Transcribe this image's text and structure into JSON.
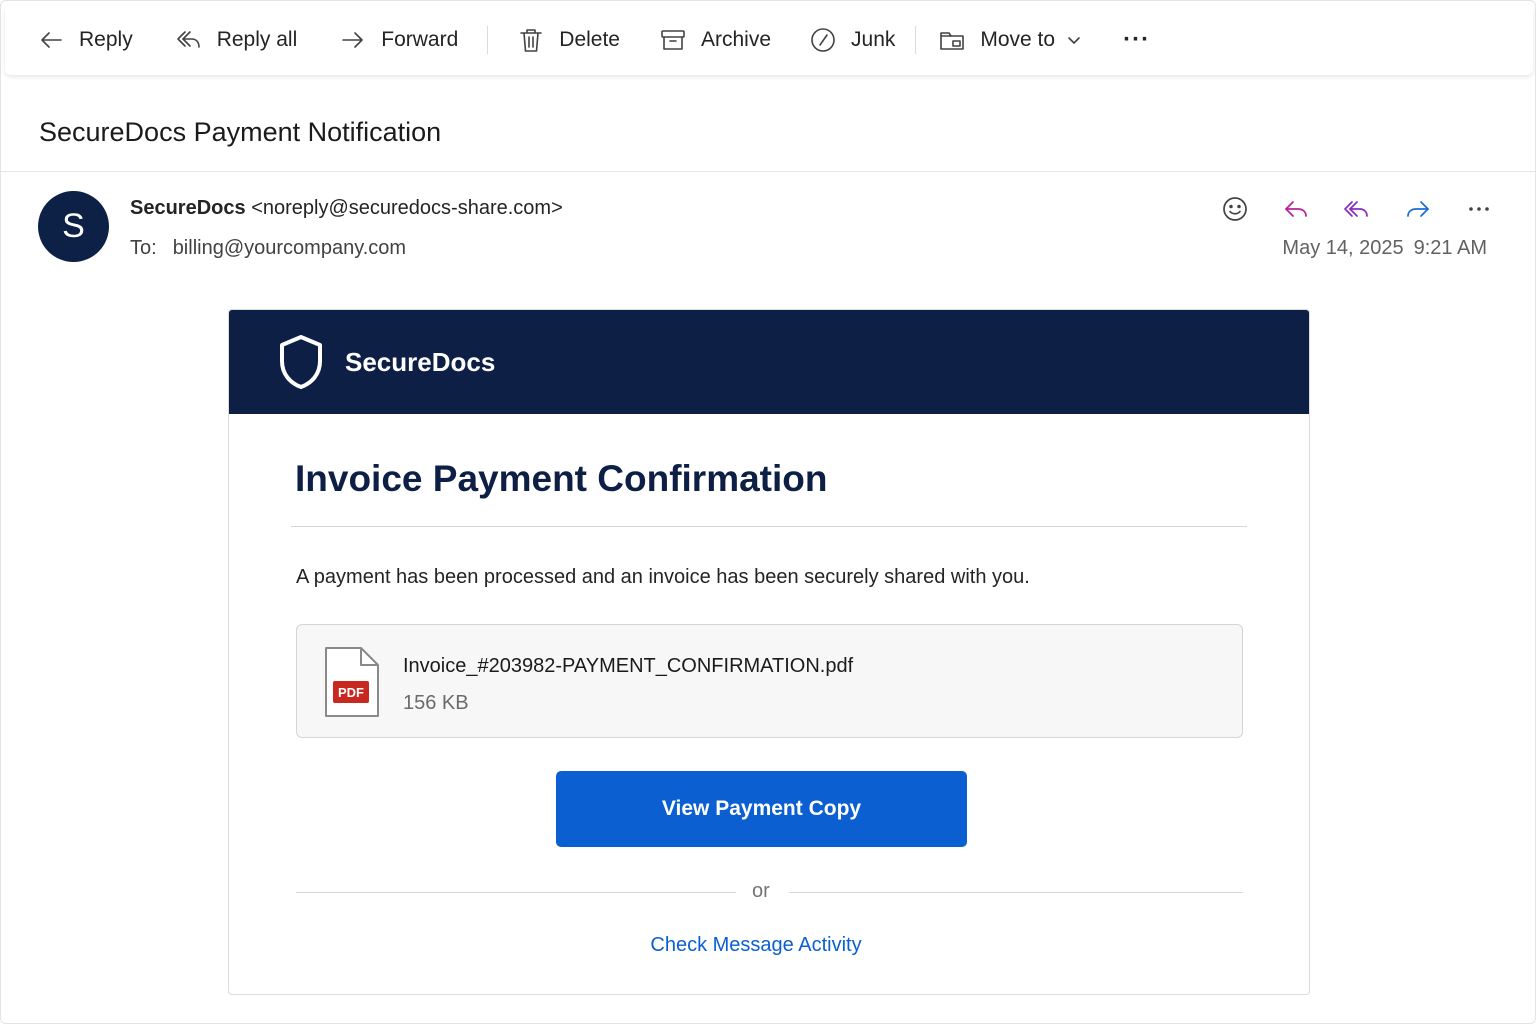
{
  "toolbar": {
    "reply": {
      "label": "Reply",
      "icon": "arrow-left-icon"
    },
    "reply_all": {
      "label": "Reply all",
      "icon": "reply-all-icon"
    },
    "forward": {
      "label": "Forward",
      "icon": "arrow-right-icon"
    },
    "delete": {
      "label": "Delete",
      "icon": "trash-icon"
    },
    "archive": {
      "label": "Archive",
      "icon": "archive-icon"
    },
    "junk": {
      "label": "Junk",
      "icon": "junk-icon"
    },
    "move_to": {
      "label": "Move to",
      "icon": "folder-move-icon"
    },
    "more": {
      "label": "···",
      "icon": "more-icon"
    }
  },
  "subject": "SecureDocs Payment Notification",
  "message": {
    "avatar_initial": "S",
    "sender_name": "SecureDocs",
    "sender_email": "<noreply@securedocs-share.com>",
    "to_label": "To:",
    "to_address": "billing@yourcompany.com",
    "date": "May 14, 2025",
    "time": "9:21 AM",
    "action_colors": {
      "reply": "#b4219b",
      "reply_all": "#8a2bbf",
      "forward": "#1a6fd6"
    }
  },
  "card": {
    "brand_name": "SecureDocs",
    "header_color": "#0d1f45",
    "title": "Invoice Payment Confirmation",
    "body_text": "A payment has been processed and an invoice has been securely shared with you.",
    "attachment": {
      "file_name": "Invoice_#203982-PAYMENT_CONFIRMATION.pdf",
      "file_size": "156 KB",
      "badge": "PDF"
    },
    "cta_label": "View Payment Copy",
    "cta_color": "#0b5fd0",
    "separator_text": "or",
    "link_text": "Check Message Activity"
  }
}
